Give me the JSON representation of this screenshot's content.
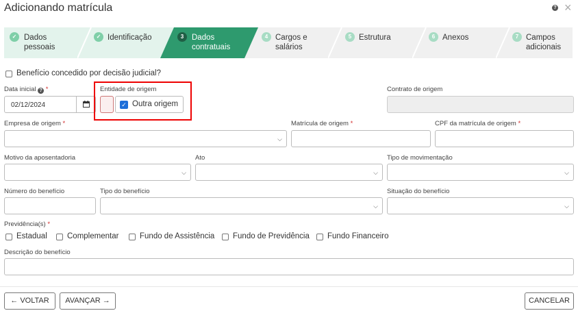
{
  "window": {
    "title": "Adicionando matrícula"
  },
  "steps": [
    {
      "number": "✓",
      "line1": "Dados",
      "line2": "pessoais",
      "state": "done"
    },
    {
      "number": "✓",
      "line1": "Identificação",
      "line2": "",
      "state": "done"
    },
    {
      "number": "3",
      "line1": "Dados",
      "line2": "contratuais",
      "state": "active"
    },
    {
      "number": "4",
      "line1": "Cargos e",
      "line2": "salários",
      "state": "pending"
    },
    {
      "number": "5",
      "line1": "Estrutura",
      "line2": "",
      "state": "pending"
    },
    {
      "number": "6",
      "line1": "Anexos",
      "line2": "",
      "state": "pending"
    },
    {
      "number": "7",
      "line1": "Campos",
      "line2": "adicionais",
      "state": "pending"
    }
  ],
  "form": {
    "beneficio_judicial": "Benefício concedido por decisão judicial?",
    "data_inicial_label": "Data inicial",
    "data_inicial_value": "02/12/2024",
    "entidade_label": "Entidade de origem",
    "outra_origem_label": "Outra origem",
    "contrato_label": "Contrato de origem",
    "empresa_label": "Empresa de origem",
    "matricula_label": "Matrícula de origem",
    "cpf_label": "CPF da matrícula de origem",
    "motivo_label": "Motivo da aposentadoria",
    "ato_label": "Ato",
    "tipo_mov_label": "Tipo de movimentação",
    "numero_beneficio_label": "Número do benefício",
    "tipo_beneficio_label": "Tipo do benefício",
    "situacao_label": "Situação do benefício",
    "previdencia_label": "Previdência(s)",
    "previdencias": [
      "Estadual",
      "Complementar",
      "Fundo de Assistência",
      "Fundo de Previdência",
      "Fundo Financeiro"
    ],
    "descricao_label": "Descrição do benefício",
    "required_mark": "*"
  },
  "footer": {
    "back_label": "VOLTAR",
    "next_label": "AVANÇAR",
    "cancel_label": "CANCELAR"
  },
  "colors": {
    "active_step": "#2e9a6e",
    "done_step": "#e3f3ec",
    "pending_step": "#f0f0f0",
    "check_blue": "#1e6fd9",
    "highlight": "#ee0000"
  }
}
